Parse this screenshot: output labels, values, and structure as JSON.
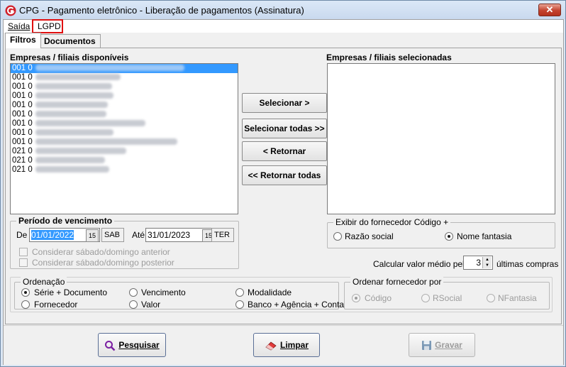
{
  "window": {
    "title": "CPG - Pagamento eletrônico - Liberação de pagamentos (Assinatura)",
    "close_glyph": "✕"
  },
  "menu": {
    "saida": "Saída",
    "lgpd": "LGPD"
  },
  "tabs": [
    {
      "label": "Filtros",
      "active": true
    },
    {
      "label": "Documentos",
      "active": false
    }
  ],
  "available": {
    "label": "Empresas / filiais disponíveis",
    "items": [
      {
        "prefix": "001 0",
        "selected": true
      },
      {
        "prefix": "001 0",
        "selected": false
      },
      {
        "prefix": "001 0",
        "selected": false
      },
      {
        "prefix": "001 0",
        "selected": false
      },
      {
        "prefix": "001 0",
        "selected": false
      },
      {
        "prefix": "001 0",
        "selected": false
      },
      {
        "prefix": "001 0",
        "selected": false
      },
      {
        "prefix": "001 0",
        "selected": false
      },
      {
        "prefix": "001 0",
        "selected": false
      },
      {
        "prefix": "021 0",
        "selected": false
      },
      {
        "prefix": "021 0",
        "selected": false
      },
      {
        "prefix": "021 0",
        "selected": false
      }
    ]
  },
  "selected_list": {
    "label": "Empresas / filiais selecionadas"
  },
  "buttons": {
    "selecionar": "Selecionar >",
    "selecionar_todas": "Selecionar todas >>",
    "retornar": "< Retornar",
    "retornar_todas": "<< Retornar todas",
    "pesquisar": "Pesquisar",
    "limpar": "Limpar",
    "gravar": "Gravar"
  },
  "periodo": {
    "title": "Período de vencimento",
    "de_label": "De",
    "de_value": "01/01/2022",
    "de_weekday": "SAB",
    "ate_label": "Até",
    "ate_value": "31/01/2023",
    "ate_weekday": "TER",
    "cal_glyph": "15",
    "check_anterior": "Considerar sábado/domingo anterior",
    "check_posterior": "Considerar sábado/domingo posterior"
  },
  "exibir": {
    "title": "Exibir do fornecedor Código +",
    "razao": "Razão social",
    "fantasia": "Nome fantasia",
    "selected": "fantasia"
  },
  "calcular": {
    "label": "Calcular valor médio pelas",
    "value": "3",
    "suffix": "últimas compras"
  },
  "ordenacao": {
    "title": "Ordenação",
    "options": [
      "Série + Documento",
      "Vencimento",
      "Modalidade",
      "Fornecedor",
      "Valor",
      "Banco + Agência + Conta"
    ],
    "selected": "Série + Documento"
  },
  "ordenar_fornecedor": {
    "title": "Ordenar fornecedor por",
    "options": [
      "Código",
      "RSocial",
      "NFantasia"
    ],
    "selected": "Código"
  },
  "colors": {
    "selection": "#3399ff",
    "highlight_box": "#e01010",
    "disabled_text": "#9c9c9c"
  }
}
